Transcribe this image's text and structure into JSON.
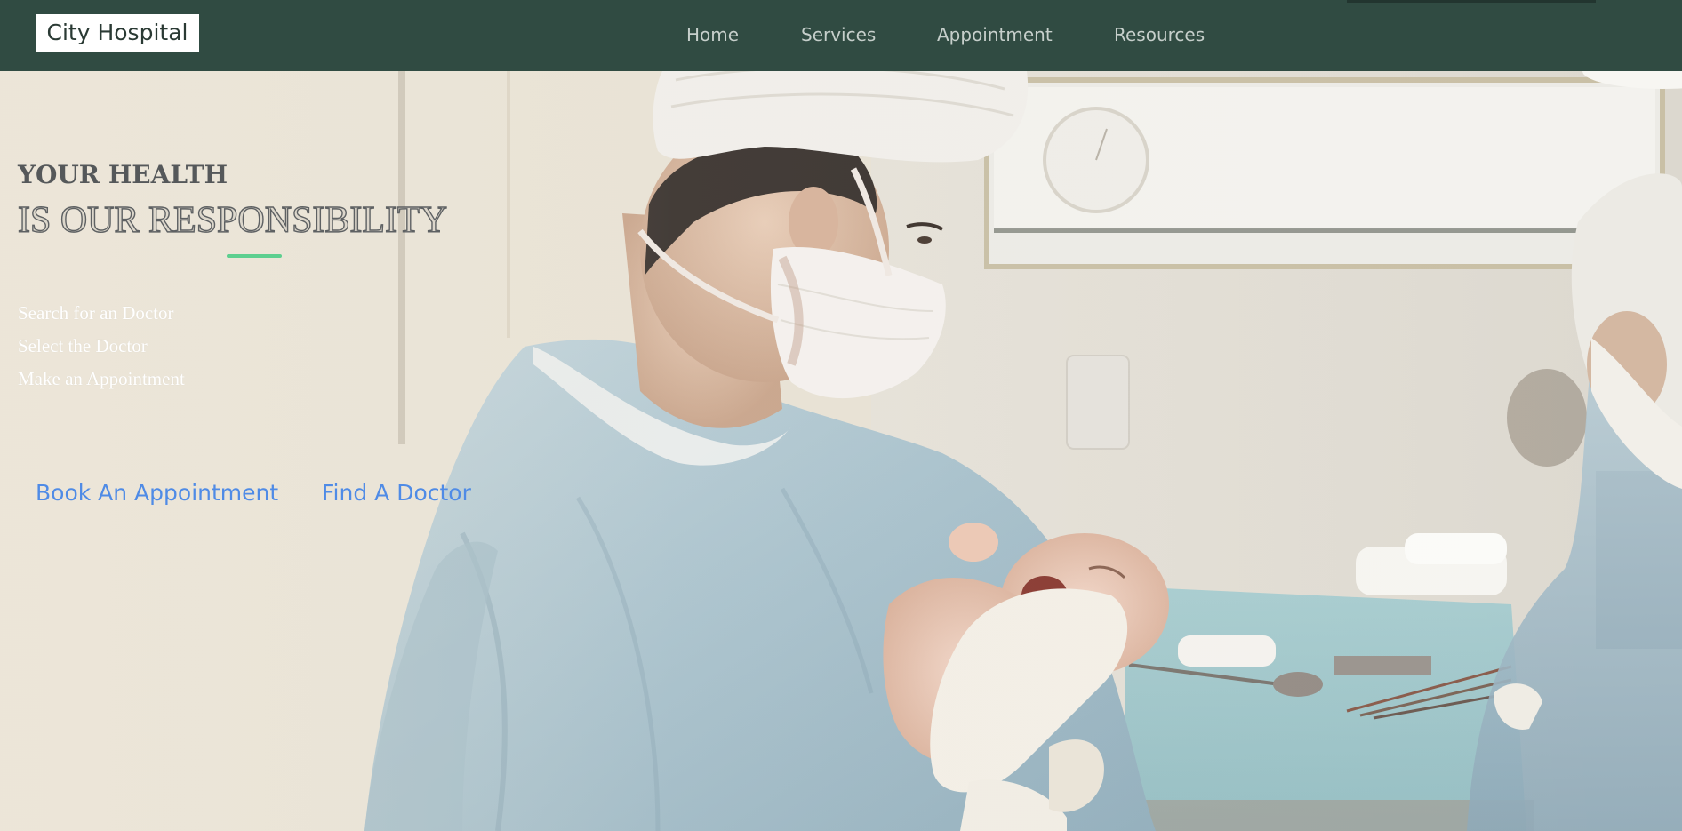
{
  "navbar": {
    "brand": "City Hospital",
    "links": [
      {
        "label": "Home"
      },
      {
        "label": "Services"
      },
      {
        "label": "Appointment"
      },
      {
        "label": "Resources"
      }
    ]
  },
  "hero": {
    "headline_line1": "YOUR HEALTH",
    "headline_line2": "IS OUR RESPONSIBILITY",
    "steps": [
      "Search for an Doctor",
      "Select the Doctor",
      "Make an Appointment"
    ],
    "buttons": {
      "book": "Book An Appointment",
      "find": "Find A Doctor"
    },
    "background_image": "surgeon-holding-newborn-photo"
  },
  "colors": {
    "nav_bg": "#304b42",
    "nav_link": "#c6cfcb",
    "accent": "#5dcf8f",
    "cta": "#4f8be6"
  }
}
